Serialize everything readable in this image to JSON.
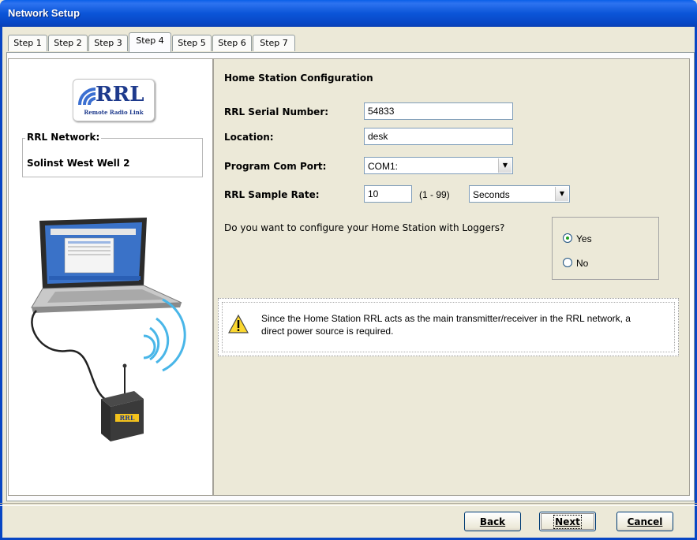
{
  "window": {
    "title": "Network Setup"
  },
  "tabs": [
    "Step 1",
    "Step 2",
    "Step 3",
    "Step 4",
    "Step 5",
    "Step 6",
    "Step 7"
  ],
  "active_tab": "Step 4",
  "left_panel": {
    "logo_text": "RRL",
    "logo_subtext": "Remote Radio Link",
    "network_label": "RRL Network:",
    "network_name": "Solinst West Well 2"
  },
  "form": {
    "section_title": "Home Station Configuration",
    "serial_label": "RRL Serial Number:",
    "serial_value": "54833",
    "location_label": "Location:",
    "location_value": "desk",
    "comport_label": "Program Com Port:",
    "comport_value": "COM1:",
    "sample_rate_label": "RRL Sample Rate:",
    "sample_rate_value": "10",
    "sample_rate_range": "(1 - 99)",
    "sample_rate_unit": "Seconds",
    "question": "Do you want to configure your Home Station with Loggers?",
    "options": [
      "Yes",
      "No"
    ],
    "selected_option": "Yes"
  },
  "notice": {
    "text": "Since the Home Station RRL acts as the main transmitter/receiver in the RRL network, a direct power source is required."
  },
  "buttons": {
    "back": "Back",
    "next": "Next",
    "cancel": "Cancel"
  },
  "colors": {
    "title_bar": "#0846c4",
    "face": "#ece9d8",
    "logo_blue": "#1e3a8c"
  }
}
